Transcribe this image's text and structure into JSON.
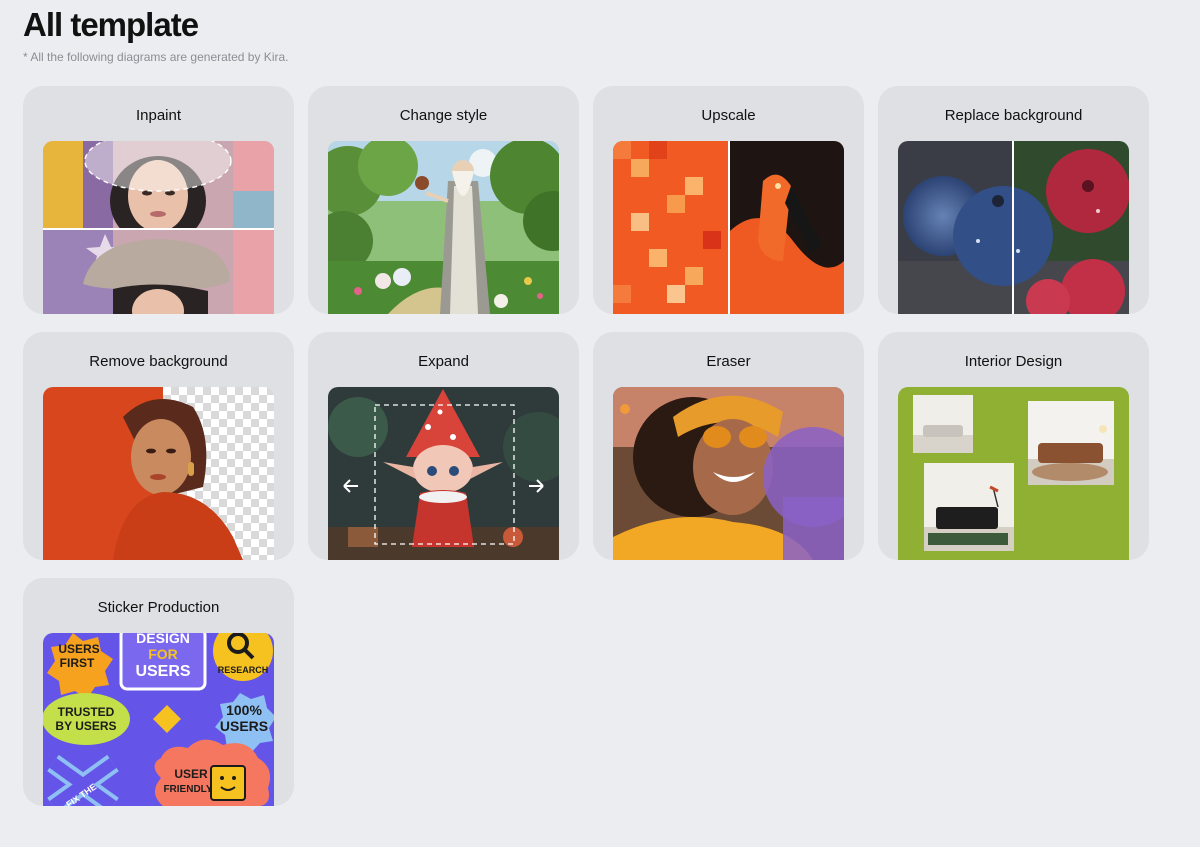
{
  "page": {
    "title": "All template",
    "subtitle": "* All the following diagrams are generated by Kira."
  },
  "templates": [
    {
      "label": "Inpaint",
      "image": "woman-beret-inpaint-image"
    },
    {
      "label": "Change style",
      "image": "wizard-forest-illustration-image"
    },
    {
      "label": "Upscale",
      "image": "flamingo-pixelated-comparison-image"
    },
    {
      "label": "Replace background",
      "image": "berries-split-comparison-image"
    },
    {
      "label": "Remove background",
      "image": "woman-orange-background-removed-image"
    },
    {
      "label": "Expand",
      "image": "elf-character-expand-image"
    },
    {
      "label": "Eraser",
      "image": "smiling-woman-sunglasses-image"
    },
    {
      "label": "Interior Design",
      "image": "sofa-rooms-collage-image"
    },
    {
      "label": "Sticker Production",
      "image": "ux-stickers-sheet-image"
    }
  ],
  "stickers": {
    "users_first": "USERS FIRST",
    "design_for_users": "DESIGN FOR USERS",
    "research": "RESEARCH",
    "trusted_by_users": "TRUSTED BY USERS",
    "hundred_users": "100% USERS",
    "user_friendly": "USER FRIENDLY",
    "fix_the_problem": "FIX THE BLEM"
  },
  "colors": {
    "page_bg": "#ecedf0",
    "card_bg": "#dfe0e3",
    "sticker_sheet_bg": "#6554e8",
    "interior_bg": "#8fb032"
  }
}
